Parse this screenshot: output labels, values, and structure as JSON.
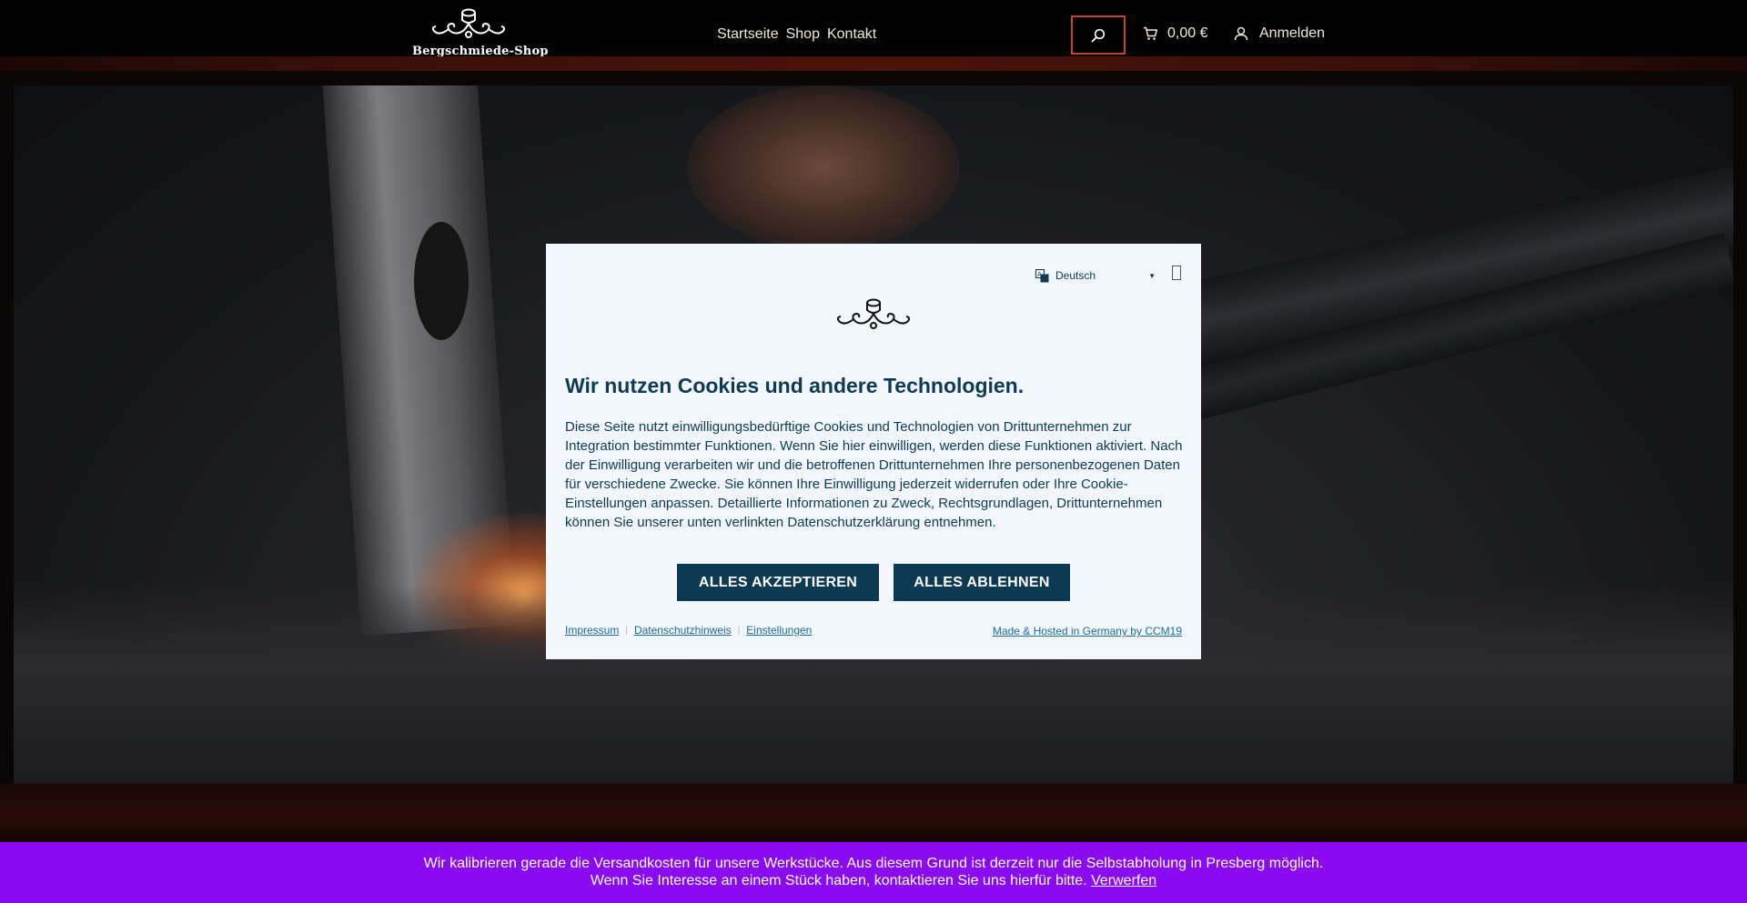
{
  "header": {
    "logo_text": "Bergschmiede-Shop",
    "nav": [
      {
        "label": "Startseite"
      },
      {
        "label": "Shop"
      },
      {
        "label": "Kontakt"
      }
    ],
    "cart_total": "0,00 €",
    "login_label": "Anmelden",
    "search_border_color": "#c2452a"
  },
  "cookie_modal": {
    "language": "Deutsch",
    "title": "Wir nutzen Cookies und andere Technologien.",
    "body": "Diese Seite nutzt einwilligungsbedürftige Cookies und Technologien von Drittunternehmen zur Integration bestimmter Funktionen. Wenn Sie hier einwilligen, werden diese Funktionen aktiviert. Nach der Einwilligung verarbeiten wir und die betroffenen Drittunternehmen Ihre personenbezogenen Daten für verschiedene Zwecke. Sie können Ihre Einwilligung jederzeit widerrufen oder Ihre Cookie-Einstellungen anpassen. Detaillierte Informationen zu Zweck, Rechtsgrundlagen, Drittunternehmen können Sie unserer unten verlinkten Datenschutzerklärung entnehmen.",
    "accept_label": "ALLES AKZEPTIEREN",
    "reject_label": "ALLES ABLEHNEN",
    "links": [
      {
        "label": "Impressum"
      },
      {
        "label": "Datenschutzhinweis"
      },
      {
        "label": "Einstellungen"
      }
    ],
    "made_by": "Made & Hosted in Germany by CCM19",
    "button_color": "#0c3a52"
  },
  "notice": {
    "line1": "Wir kalibrieren gerade die Versandkosten für unsere Werkstücke. Aus diesem Grund ist derzeit nur die Selbstabholung in Presberg möglich.",
    "line2": "Wenn Sie Interesse an einem Stück haben, kontaktieren Sie uns hierfür bitte.",
    "dismiss_label": "Verwerfen",
    "background_color": "#8a0bf2"
  },
  "icons": {
    "search": "search-icon",
    "cart": "cart-icon",
    "user": "user-icon",
    "language": "language-icon",
    "close": "close-icon"
  }
}
